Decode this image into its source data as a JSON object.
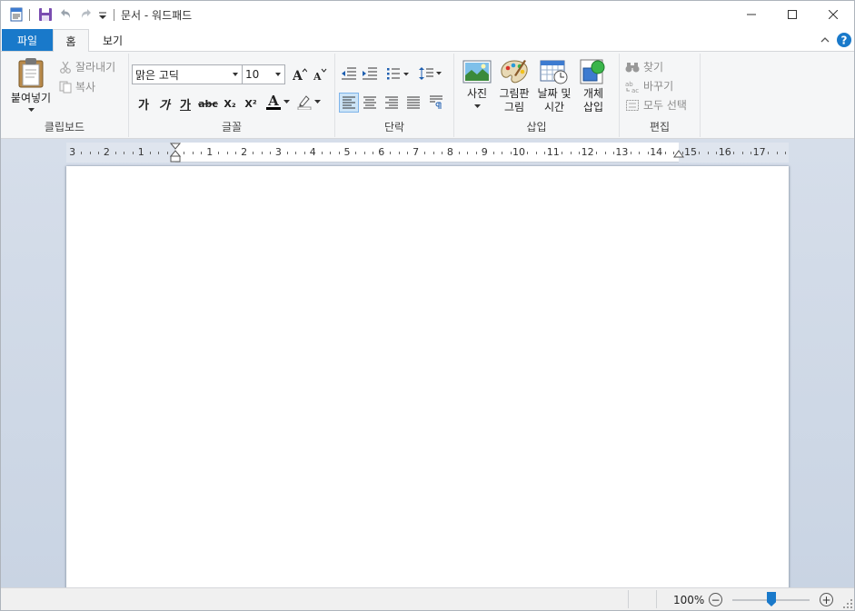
{
  "window": {
    "title": "문서 - 워드패드"
  },
  "ribbon_tabs": {
    "file": "파일",
    "home": "홈",
    "view": "보기"
  },
  "clipboard": {
    "paste": "붙여넣기",
    "cut": "잘라내기",
    "copy": "복사",
    "label": "클립보드"
  },
  "font": {
    "family": "맑은 고딕",
    "size": "10",
    "label": "글꼴",
    "bold": "가",
    "italic": "가",
    "underline": "가",
    "strike": "abc",
    "subscript": "X₂",
    "superscript": "X²",
    "text_color_glyph": "A"
  },
  "paragraph": {
    "label": "단락"
  },
  "insert": {
    "picture": "사진",
    "paint_line1": "그림판",
    "paint_line2": "그림",
    "datetime_line1": "날짜 및",
    "datetime_line2": "시간",
    "object_line1": "개체",
    "object_line2": "삽입",
    "label": "삽입"
  },
  "editing": {
    "find": "찾기",
    "replace": "바꾸기",
    "select_all": "모두 선택",
    "label": "편집"
  },
  "ruler": {
    "left_labels": [
      "3",
      "2",
      "1"
    ],
    "right_labels": [
      "1",
      "2",
      "3",
      "4",
      "5",
      "6",
      "7",
      "8",
      "9",
      "10",
      "11",
      "12",
      "13",
      "14",
      "15",
      "16",
      "17"
    ]
  },
  "status": {
    "zoom": "100%",
    "zoom_out": "−",
    "zoom_in": "+"
  },
  "colors": {
    "accent": "#1979ca",
    "ribbon_bg": "#f5f6f7",
    "workspace": "#ccd6e4",
    "help": "#1979ca"
  },
  "icons": {
    "app": "wordpad-icon",
    "save": "save-icon",
    "undo": "undo-icon",
    "redo": "redo-icon",
    "minimize": "minimize-icon",
    "maximize": "maximize-icon",
    "close": "close-icon",
    "collapse": "chevron-up-icon",
    "help": "help-icon"
  }
}
